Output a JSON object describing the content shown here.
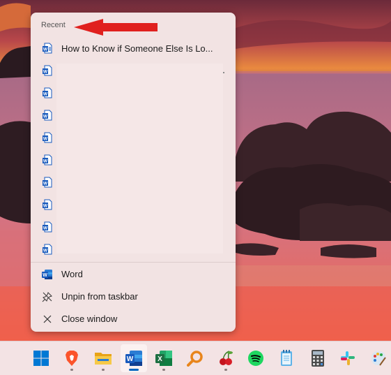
{
  "jumplist": {
    "section_title": "Recent",
    "recent_items": [
      {
        "label": "How to Know if Someone Else Is Lo...",
        "icon": "word-doc-icon"
      },
      {
        "label": "",
        "icon": "word-doc-icon"
      },
      {
        "label": "",
        "icon": "word-doc-icon"
      },
      {
        "label": "",
        "icon": "word-doc-icon"
      },
      {
        "label": "",
        "icon": "word-doc-icon"
      },
      {
        "label": "",
        "icon": "word-doc-icon"
      },
      {
        "label": "",
        "icon": "word-doc-icon"
      },
      {
        "label": "",
        "icon": "word-doc-icon"
      },
      {
        "label": "",
        "icon": "word-doc-icon"
      },
      {
        "label": "",
        "icon": "word-doc-icon"
      }
    ],
    "tasks": [
      {
        "label": "Word",
        "icon": "word-app-icon"
      },
      {
        "label": "Unpin from taskbar",
        "icon": "unpin-icon"
      },
      {
        "label": "Close window",
        "icon": "close-icon"
      }
    ]
  },
  "taskbar": {
    "apps": [
      {
        "name": "start",
        "icon": "windows-start-icon"
      },
      {
        "name": "brave",
        "icon": "brave-browser-icon"
      },
      {
        "name": "file-explorer",
        "icon": "folder-icon"
      },
      {
        "name": "word",
        "icon": "word-app-icon",
        "active": true
      },
      {
        "name": "excel",
        "icon": "excel-app-icon"
      },
      {
        "name": "search-tool",
        "icon": "magnifier-icon"
      },
      {
        "name": "cherry-app",
        "icon": "cherry-icon"
      },
      {
        "name": "spotify",
        "icon": "spotify-icon"
      },
      {
        "name": "notepad",
        "icon": "notepad-icon"
      },
      {
        "name": "calculator",
        "icon": "calculator-icon"
      },
      {
        "name": "slack",
        "icon": "slack-icon"
      },
      {
        "name": "paint",
        "icon": "paint-palette-icon"
      }
    ]
  },
  "colors": {
    "menu_bg": "#f2e3e3",
    "word_blue": "#185abd",
    "excel_green": "#1d6f42",
    "annotation_red": "#e0201e",
    "taskbar_bg": "#f3e3e4"
  }
}
